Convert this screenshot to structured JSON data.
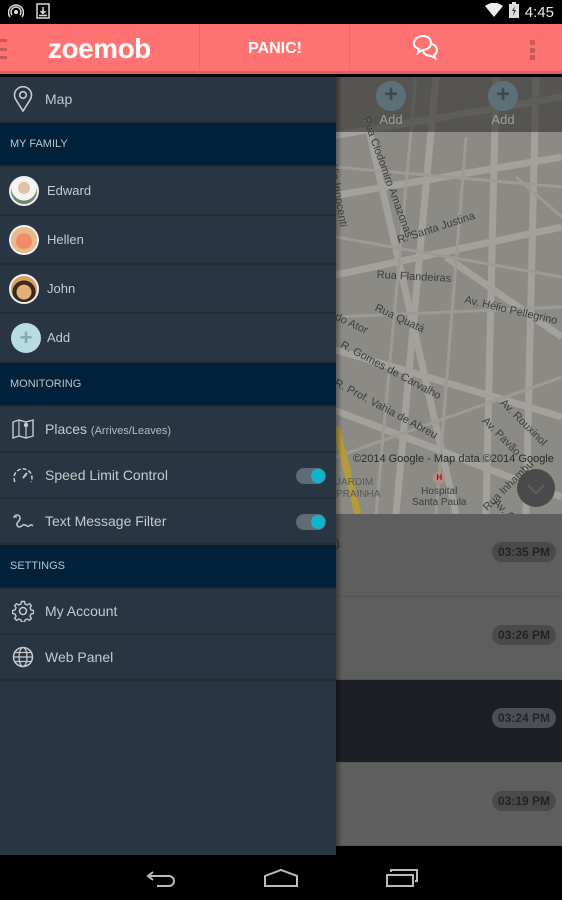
{
  "status_bar": {
    "time": "4:45",
    "icons": [
      "hotspot-icon",
      "download-icon",
      "wifi-icon",
      "battery-charging-icon"
    ]
  },
  "app_bar": {
    "logo": "zoemob",
    "panic_label": "PANIC!",
    "chat_icon": "chat-bubbles-icon",
    "menu_icon": "hamburger-icon",
    "overflow_icon": "overflow-menu-icon"
  },
  "drawer": {
    "map_item": {
      "label": "Map",
      "icon": "map-pin-icon"
    },
    "sections": [
      {
        "title": "MY FAMILY"
      },
      {
        "title": "MONITORING"
      },
      {
        "title": "SETTINGS"
      }
    ],
    "family": [
      {
        "name": "Edward",
        "avatar": "avatar-edward"
      },
      {
        "name": "Hellen",
        "avatar": "avatar-hellen"
      },
      {
        "name": "John",
        "avatar": "avatar-john"
      },
      {
        "name": "Add",
        "avatar": "add-icon"
      }
    ],
    "monitoring": [
      {
        "label": "Places",
        "sublabel": "(Arrives/Leaves)",
        "icon": "map-marker-icon"
      },
      {
        "label": "Speed Limit Control",
        "icon": "speedometer-icon",
        "toggle": true
      },
      {
        "label": "Text Message Filter",
        "icon": "worm-icon",
        "toggle": true
      }
    ],
    "settings": [
      {
        "label": "My Account",
        "icon": "gear-icon"
      },
      {
        "label": "Web Panel",
        "icon": "globe-icon"
      }
    ],
    "toggle_on_color": "#10b4cc"
  },
  "background": {
    "add_buttons": [
      {
        "label": "Add"
      },
      {
        "label": "Add"
      }
    ],
    "map_labels": [
      "Rua Clodomiro Amazonas",
      "R. Santa Justina",
      "Rua Flandeiras",
      "Av. Hélio Pellegrino",
      "Rua Quatá",
      "do Ator",
      "R. Gomes de Carvalho",
      "R. Prof. Vahia de Abreu",
      "Av. Rouxinol",
      "Av. Pavão",
      "Rua Inhambu",
      "Av. Coti",
      "úlio Innocenti"
    ],
    "hospital": {
      "line1": "Hospital",
      "line2": "Santa Paula"
    },
    "jardim": {
      "line1": "JARDIM",
      "line2": "PRAINHA"
    },
    "copyright": "©2014 Google - Map data ©2014 Google",
    "timeline": [
      {
        "time": "03:35 PM",
        "snippet": ")."
      },
      {
        "time": "03:26 PM",
        "snippet": ""
      },
      {
        "time": "03:24 PM",
        "snippet": ""
      },
      {
        "time": "03:19 PM",
        "snippet": ""
      }
    ]
  },
  "nav_bar": {
    "buttons": [
      "back-icon",
      "home-icon",
      "recent-apps-icon"
    ]
  },
  "colors": {
    "app_bar": "#ff7272",
    "drawer_bg": "#283542",
    "section_bg": "#01213a"
  }
}
